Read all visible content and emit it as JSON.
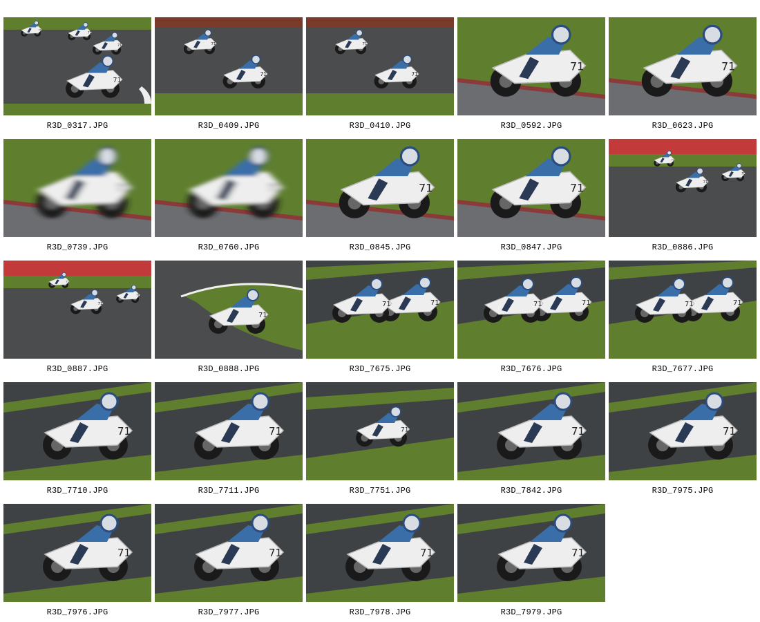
{
  "gallery": {
    "items": [
      {
        "filename": "R3D_0317.JPG",
        "scene": "asphalt-pack",
        "blur": false
      },
      {
        "filename": "R3D_0409.JPG",
        "scene": "asphalt-dark",
        "blur": false
      },
      {
        "filename": "R3D_0410.JPG",
        "scene": "asphalt-dark",
        "blur": false
      },
      {
        "filename": "R3D_0592.JPG",
        "scene": "grass-close",
        "blur": false
      },
      {
        "filename": "R3D_0623.JPG",
        "scene": "grass-close",
        "blur": false
      },
      {
        "filename": "R3D_0739.JPG",
        "scene": "grass-close",
        "blur": true
      },
      {
        "filename": "R3D_0760.JPG",
        "scene": "grass-close",
        "blur": true
      },
      {
        "filename": "R3D_0845.JPG",
        "scene": "grass-close",
        "blur": false
      },
      {
        "filename": "R3D_0847.JPG",
        "scene": "grass-close",
        "blur": false
      },
      {
        "filename": "R3D_0886.JPG",
        "scene": "asphalt-far",
        "blur": false
      },
      {
        "filename": "R3D_0887.JPG",
        "scene": "asphalt-far",
        "blur": false
      },
      {
        "filename": "R3D_0888.JPG",
        "scene": "corner-grass",
        "blur": false
      },
      {
        "filename": "R3D_7675.JPG",
        "scene": "wet-pair",
        "blur": false
      },
      {
        "filename": "R3D_7676.JPG",
        "scene": "wet-pair",
        "blur": false
      },
      {
        "filename": "R3D_7677.JPG",
        "scene": "wet-pair",
        "blur": false
      },
      {
        "filename": "R3D_7710.JPG",
        "scene": "wet-lean",
        "blur": false
      },
      {
        "filename": "R3D_7711.JPG",
        "scene": "wet-lean",
        "blur": false
      },
      {
        "filename": "R3D_7751.JPG",
        "scene": "wet-small",
        "blur": false
      },
      {
        "filename": "R3D_7842.JPG",
        "scene": "wet-lean",
        "blur": false
      },
      {
        "filename": "R3D_7975.JPG",
        "scene": "wet-lean",
        "blur": false
      },
      {
        "filename": "R3D_7976.JPG",
        "scene": "wet-lean",
        "blur": false
      },
      {
        "filename": "R3D_7977.JPG",
        "scene": "wet-lean",
        "blur": false
      },
      {
        "filename": "R3D_7978.JPG",
        "scene": "wet-lean",
        "blur": false
      },
      {
        "filename": "R3D_7979.JPG",
        "scene": "wet-lean",
        "blur": false
      }
    ]
  },
  "colors": {
    "grass": "#5f7f2e",
    "asphalt": "#4a4c4e",
    "wet_asphalt": "#3f4244",
    "bike": "#eeeeee",
    "rider": "#3a6ea8"
  }
}
